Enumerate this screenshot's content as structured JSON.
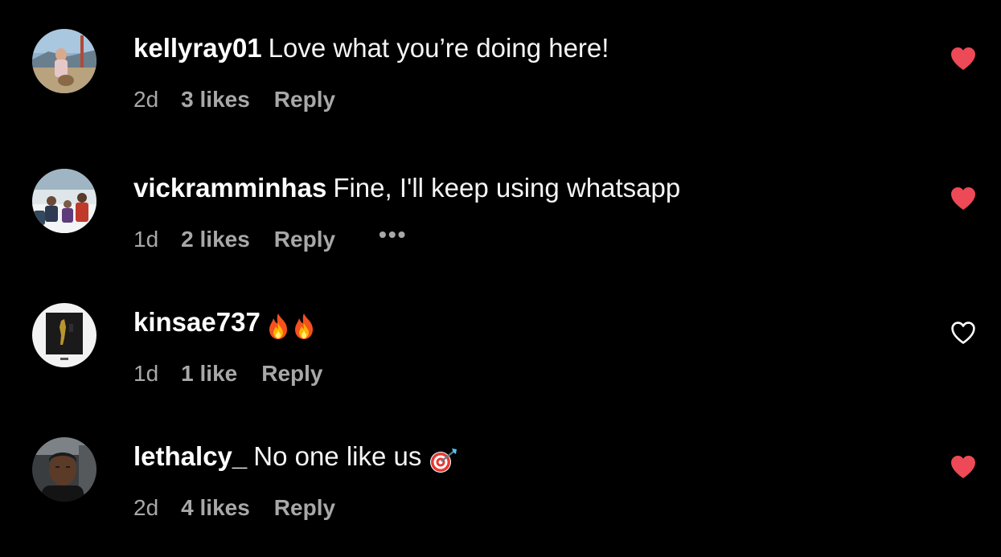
{
  "colors": {
    "background": "#000000",
    "primary_text": "#f5f5f5",
    "secondary_text": "#a8a8a8",
    "liked_heart": "#ed4956",
    "unliked_heart": "#ffffff"
  },
  "comments": [
    {
      "username": "kellyray01",
      "text": "Love what you’re doing here!",
      "time": "2d",
      "likes": "3 likes",
      "reply_label": "Reply",
      "liked": true,
      "avatar_icon": "profile-photo"
    },
    {
      "username": "vickramminhas",
      "text": "Fine, I'll keep using whatsapp",
      "time": "1d",
      "likes": "2 likes",
      "reply_label": "Reply",
      "more_label": "•••",
      "liked": true,
      "avatar_icon": "profile-photo"
    },
    {
      "username": "kinsae737",
      "text": "",
      "emojis": [
        "fire-emoji",
        "fire-emoji"
      ],
      "time": "1d",
      "likes": "1 like",
      "reply_label": "Reply",
      "liked": false,
      "avatar_icon": "profile-photo"
    },
    {
      "username": "lethalcy_",
      "text": "No one like us",
      "emojis": [
        "direct-hit-emoji"
      ],
      "time": "2d",
      "likes": "4 likes",
      "reply_label": "Reply",
      "liked": true,
      "avatar_icon": "profile-photo"
    }
  ]
}
